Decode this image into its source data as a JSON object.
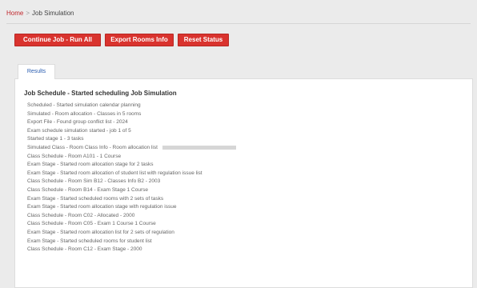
{
  "breadcrumb": {
    "home": "Home",
    "separator": ">",
    "current": "Job Simulation"
  },
  "toolbar": {
    "buttons": [
      "Continue Job - Run All",
      "Export Rooms Info",
      "Reset Status"
    ]
  },
  "tabs": [
    "Results"
  ],
  "log": {
    "title": "Job Schedule - Started scheduling Job Simulation",
    "lines": [
      "Scheduled - Started simulation calendar planning",
      "Simulated - Room allocation - Classes in 5 rooms",
      "Export File - Found group conflict list - 2024",
      "Exam schedule simulation started - job 1 of 5",
      "Started stage 1 - 3 tasks",
      "Simulated Class - Room Class Info - Room allocation list",
      "Class Schedule - Room A101 - 1 Course",
      "Exam Stage - Started room allocation stage for 2 tasks",
      "Exam Stage - Started room allocation of student list with regulation issue list",
      "Class Schedule - Room Sim B12 - Classes Info B2 - 2003",
      "Class Schedule - Room B14 - Exam Stage 1 Course",
      "Exam Stage - Started scheduled rooms with 2 sets of tasks",
      "Exam Stage - Started room allocation stage with regulation issue",
      "Class Schedule - Room C02 - Allocated - 2000",
      "Class Schedule - Room C05 - Exam 1 Course 1 Course",
      "Exam Stage - Started room allocation list for 2 sets of regulation",
      "Exam Stage - Started scheduled rooms for student list",
      "Class Schedule - Room C12 - Exam Stage - 2000"
    ]
  }
}
